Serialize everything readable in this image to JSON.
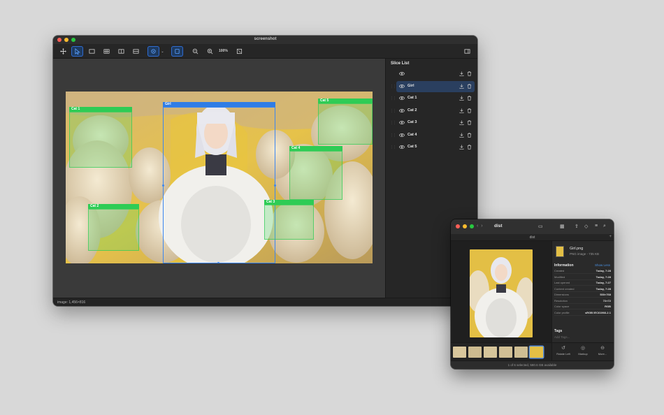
{
  "main_window": {
    "title": "screenshot",
    "zoom": "100%",
    "status": "image: 1,456×816"
  },
  "slices": [
    {
      "name": ""
    },
    {
      "name": "Girl"
    },
    {
      "name": "Cat 1"
    },
    {
      "name": "Cat 2"
    },
    {
      "name": "Cat 3"
    },
    {
      "name": "Cat 4"
    },
    {
      "name": "Cat 5"
    }
  ],
  "slice_list": {
    "title": "Slice List",
    "selected": "Girl"
  },
  "canvas_labels": {
    "girl": "Girl",
    "cat1": "Cat 1",
    "cat2": "Cat 2",
    "cat3": "Cat 3",
    "cat4": "Cat 4",
    "cat5": "Cat 5"
  },
  "finder": {
    "title": "dist",
    "path": "dist",
    "file_name": "Girl.png",
    "file_meta": "PNG image - 735 KB",
    "information_label": "Information",
    "show_less": "Show Less",
    "info": [
      {
        "k": "Created",
        "v": "Today, 7:28"
      },
      {
        "k": "Modified",
        "v": "Today, 7:28"
      },
      {
        "k": "Last opened",
        "v": "Today, 7:27"
      },
      {
        "k": "Content created",
        "v": "Today, 7:28"
      },
      {
        "k": "Dimensions",
        "v": "530×768"
      },
      {
        "k": "Resolution",
        "v": "72×72"
      },
      {
        "k": "Color space",
        "v": "RGB"
      },
      {
        "k": "Color profile",
        "v": "sRGB IEC61966-2.1"
      }
    ],
    "tags_label": "Tags",
    "add_tags": "Add Tags...",
    "actions": [
      "Rotate Left",
      "Markup",
      "More..."
    ],
    "status": "1 of 6 selected, 580.6 GB available"
  },
  "colors": {
    "slice_green": "#2ecc55",
    "slice_blue": "#2f7de6",
    "selection": "#2a3f5f"
  },
  "icons": [
    "move-icon",
    "pointer-icon",
    "rect-icon",
    "grid-icon",
    "columns-icon",
    "rows-icon",
    "magic-icon",
    "chevron-down-icon",
    "frame-icon",
    "zoom-out-icon",
    "zoom-in-icon",
    "fit-icon",
    "sidebar-icon",
    "eye-icon",
    "download-icon",
    "trash-icon"
  ]
}
